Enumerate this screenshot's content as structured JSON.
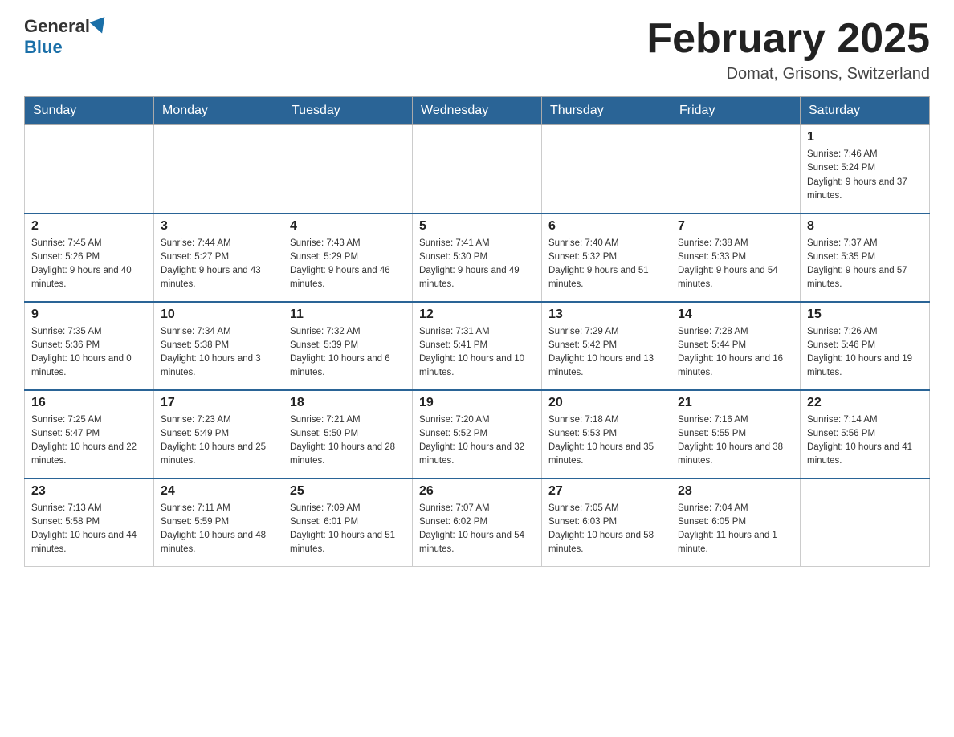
{
  "header": {
    "logo_general": "General",
    "logo_blue": "Blue",
    "month_title": "February 2025",
    "location": "Domat, Grisons, Switzerland"
  },
  "weekdays": [
    "Sunday",
    "Monday",
    "Tuesday",
    "Wednesday",
    "Thursday",
    "Friday",
    "Saturday"
  ],
  "weeks": [
    [
      {
        "day": "",
        "info": ""
      },
      {
        "day": "",
        "info": ""
      },
      {
        "day": "",
        "info": ""
      },
      {
        "day": "",
        "info": ""
      },
      {
        "day": "",
        "info": ""
      },
      {
        "day": "",
        "info": ""
      },
      {
        "day": "1",
        "info": "Sunrise: 7:46 AM\nSunset: 5:24 PM\nDaylight: 9 hours and 37 minutes."
      }
    ],
    [
      {
        "day": "2",
        "info": "Sunrise: 7:45 AM\nSunset: 5:26 PM\nDaylight: 9 hours and 40 minutes."
      },
      {
        "day": "3",
        "info": "Sunrise: 7:44 AM\nSunset: 5:27 PM\nDaylight: 9 hours and 43 minutes."
      },
      {
        "day": "4",
        "info": "Sunrise: 7:43 AM\nSunset: 5:29 PM\nDaylight: 9 hours and 46 minutes."
      },
      {
        "day": "5",
        "info": "Sunrise: 7:41 AM\nSunset: 5:30 PM\nDaylight: 9 hours and 49 minutes."
      },
      {
        "day": "6",
        "info": "Sunrise: 7:40 AM\nSunset: 5:32 PM\nDaylight: 9 hours and 51 minutes."
      },
      {
        "day": "7",
        "info": "Sunrise: 7:38 AM\nSunset: 5:33 PM\nDaylight: 9 hours and 54 minutes."
      },
      {
        "day": "8",
        "info": "Sunrise: 7:37 AM\nSunset: 5:35 PM\nDaylight: 9 hours and 57 minutes."
      }
    ],
    [
      {
        "day": "9",
        "info": "Sunrise: 7:35 AM\nSunset: 5:36 PM\nDaylight: 10 hours and 0 minutes."
      },
      {
        "day": "10",
        "info": "Sunrise: 7:34 AM\nSunset: 5:38 PM\nDaylight: 10 hours and 3 minutes."
      },
      {
        "day": "11",
        "info": "Sunrise: 7:32 AM\nSunset: 5:39 PM\nDaylight: 10 hours and 6 minutes."
      },
      {
        "day": "12",
        "info": "Sunrise: 7:31 AM\nSunset: 5:41 PM\nDaylight: 10 hours and 10 minutes."
      },
      {
        "day": "13",
        "info": "Sunrise: 7:29 AM\nSunset: 5:42 PM\nDaylight: 10 hours and 13 minutes."
      },
      {
        "day": "14",
        "info": "Sunrise: 7:28 AM\nSunset: 5:44 PM\nDaylight: 10 hours and 16 minutes."
      },
      {
        "day": "15",
        "info": "Sunrise: 7:26 AM\nSunset: 5:46 PM\nDaylight: 10 hours and 19 minutes."
      }
    ],
    [
      {
        "day": "16",
        "info": "Sunrise: 7:25 AM\nSunset: 5:47 PM\nDaylight: 10 hours and 22 minutes."
      },
      {
        "day": "17",
        "info": "Sunrise: 7:23 AM\nSunset: 5:49 PM\nDaylight: 10 hours and 25 minutes."
      },
      {
        "day": "18",
        "info": "Sunrise: 7:21 AM\nSunset: 5:50 PM\nDaylight: 10 hours and 28 minutes."
      },
      {
        "day": "19",
        "info": "Sunrise: 7:20 AM\nSunset: 5:52 PM\nDaylight: 10 hours and 32 minutes."
      },
      {
        "day": "20",
        "info": "Sunrise: 7:18 AM\nSunset: 5:53 PM\nDaylight: 10 hours and 35 minutes."
      },
      {
        "day": "21",
        "info": "Sunrise: 7:16 AM\nSunset: 5:55 PM\nDaylight: 10 hours and 38 minutes."
      },
      {
        "day": "22",
        "info": "Sunrise: 7:14 AM\nSunset: 5:56 PM\nDaylight: 10 hours and 41 minutes."
      }
    ],
    [
      {
        "day": "23",
        "info": "Sunrise: 7:13 AM\nSunset: 5:58 PM\nDaylight: 10 hours and 44 minutes."
      },
      {
        "day": "24",
        "info": "Sunrise: 7:11 AM\nSunset: 5:59 PM\nDaylight: 10 hours and 48 minutes."
      },
      {
        "day": "25",
        "info": "Sunrise: 7:09 AM\nSunset: 6:01 PM\nDaylight: 10 hours and 51 minutes."
      },
      {
        "day": "26",
        "info": "Sunrise: 7:07 AM\nSunset: 6:02 PM\nDaylight: 10 hours and 54 minutes."
      },
      {
        "day": "27",
        "info": "Sunrise: 7:05 AM\nSunset: 6:03 PM\nDaylight: 10 hours and 58 minutes."
      },
      {
        "day": "28",
        "info": "Sunrise: 7:04 AM\nSunset: 6:05 PM\nDaylight: 11 hours and 1 minute."
      },
      {
        "day": "",
        "info": ""
      }
    ]
  ]
}
